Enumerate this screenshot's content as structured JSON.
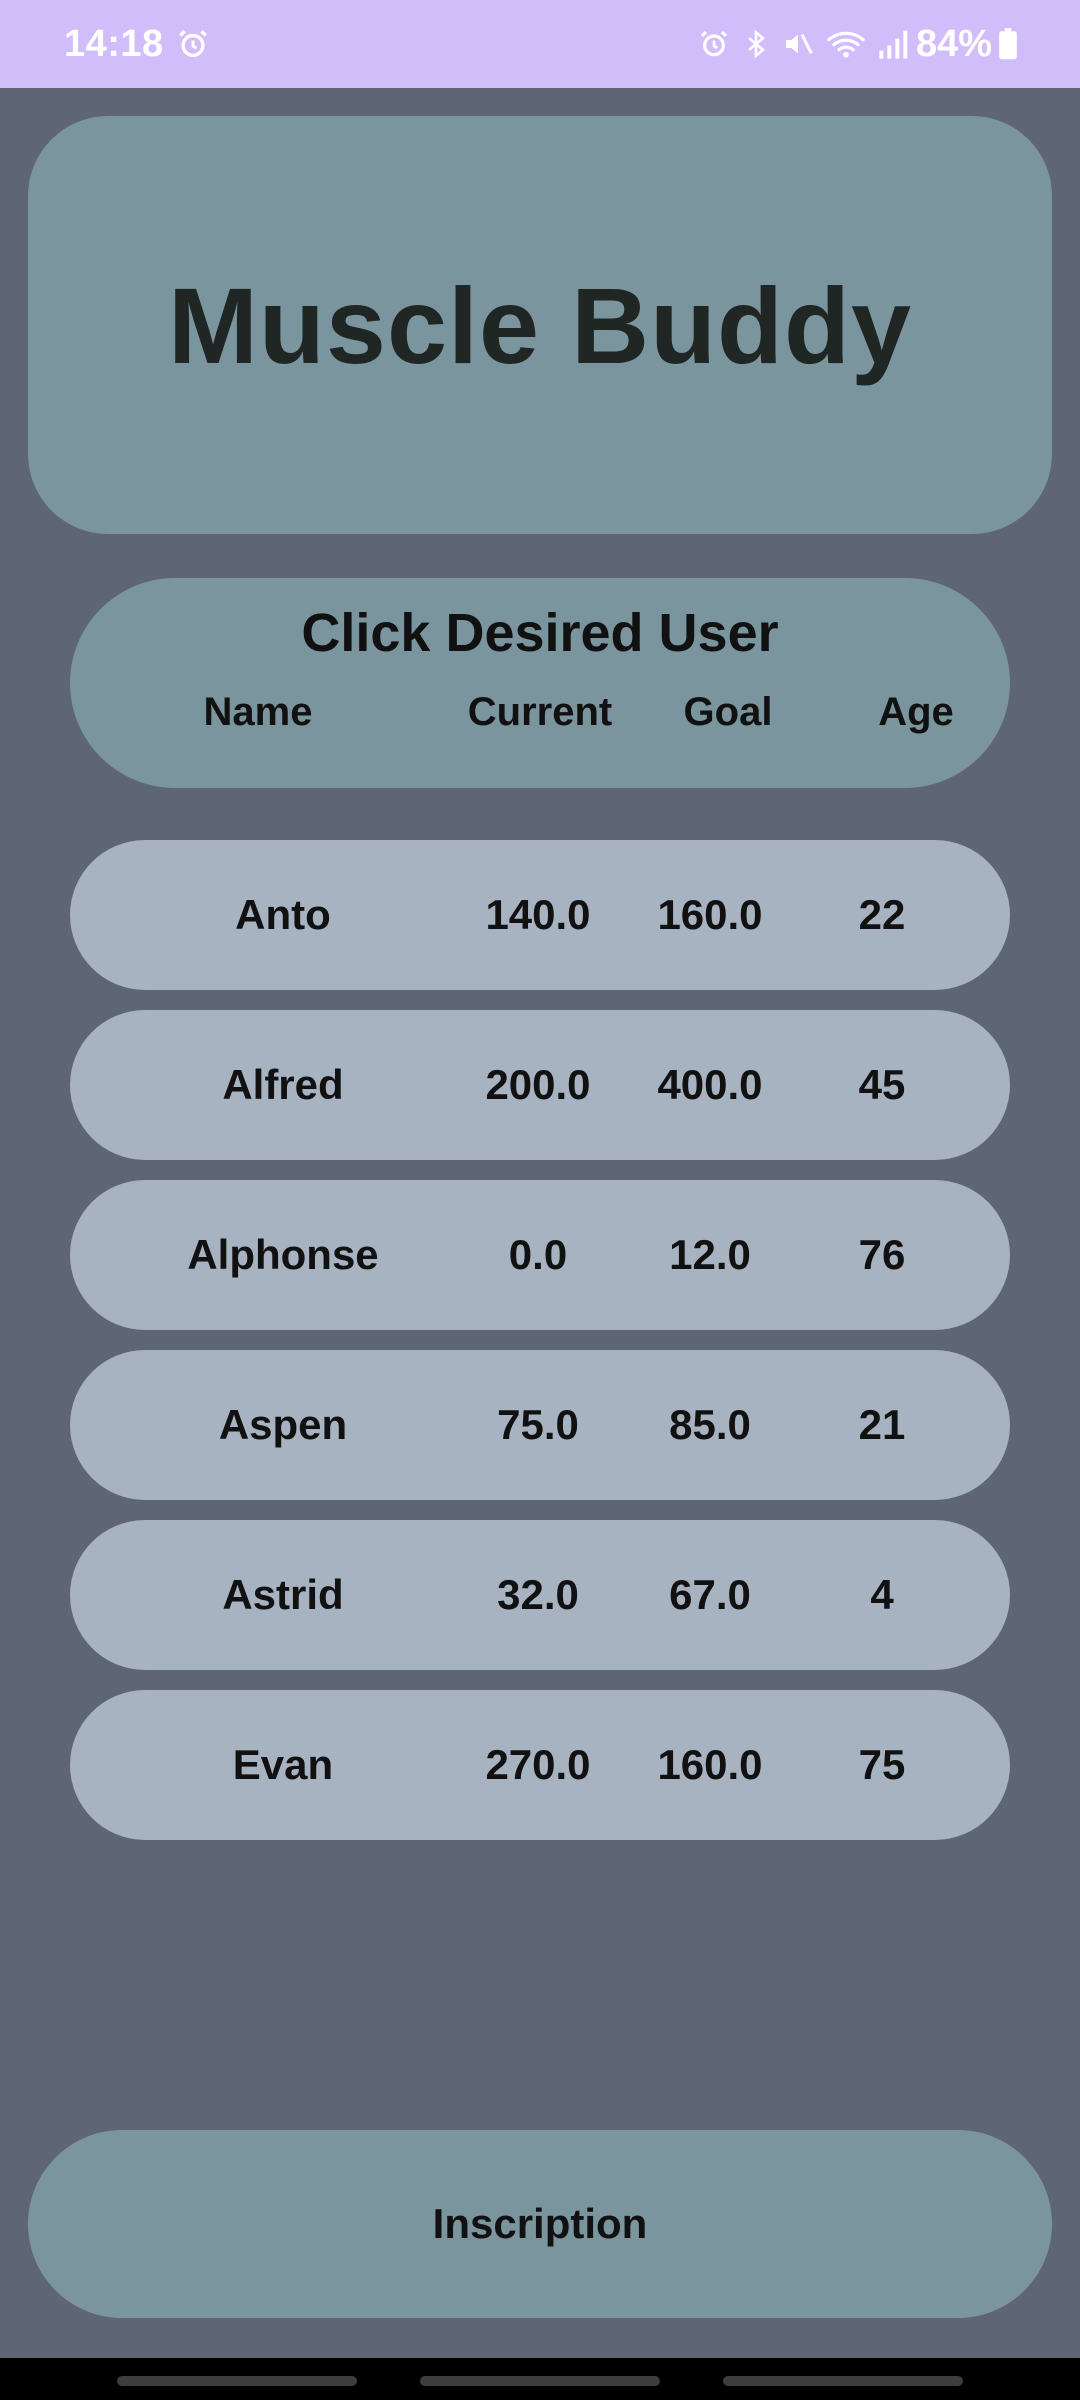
{
  "status_bar": {
    "time": "14:18",
    "battery": "84%",
    "icons_left": [
      "alarm-icon"
    ],
    "icons_right": [
      "alarm-icon",
      "bluetooth-icon",
      "mute-icon",
      "wifi-icon",
      "signal-icon",
      "battery-icon"
    ]
  },
  "header": {
    "title": "Muscle Buddy"
  },
  "table": {
    "prompt": "Click Desired User",
    "columns": [
      "Name",
      "Current",
      "Goal",
      "Age"
    ],
    "rows": [
      {
        "name": "Anto",
        "current": "140.0",
        "goal": "160.0",
        "age": "22"
      },
      {
        "name": "Alfred",
        "current": "200.0",
        "goal": "400.0",
        "age": "45"
      },
      {
        "name": "Alphonse",
        "current": "0.0",
        "goal": "12.0",
        "age": "76"
      },
      {
        "name": "Aspen",
        "current": "75.0",
        "goal": "85.0",
        "age": "21"
      },
      {
        "name": "Astrid",
        "current": "32.0",
        "goal": "67.0",
        "age": "4"
      },
      {
        "name": "Evan",
        "current": "270.0",
        "goal": "160.0",
        "age": "75"
      }
    ]
  },
  "footer": {
    "button_label": "Inscription"
  },
  "colors": {
    "status_bar": "#d2bdfb",
    "background": "#5e6575",
    "card": "#7a959d",
    "row": "#a8b3c2"
  }
}
